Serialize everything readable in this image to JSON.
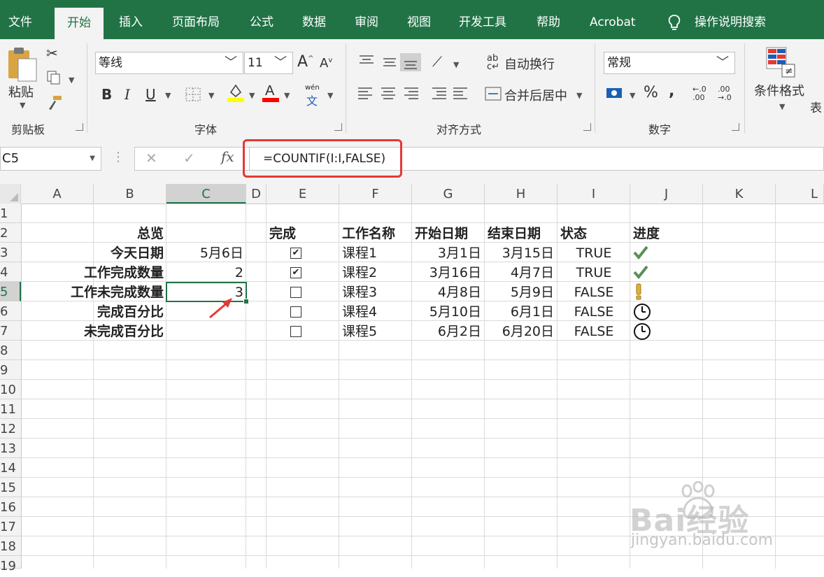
{
  "menu": {
    "tabs": [
      "文件",
      "开始",
      "插入",
      "页面布局",
      "公式",
      "数据",
      "审阅",
      "视图",
      "开发工具",
      "帮助",
      "Acrobat"
    ],
    "active_tab": "开始",
    "search_label": "操作说明搜索"
  },
  "ribbon": {
    "clipboard": {
      "paste": "粘贴",
      "group": "剪贴板"
    },
    "font": {
      "name": "等线",
      "size": "11",
      "bold": "B",
      "italic": "I",
      "underline": "U",
      "phonetic_top": "wén",
      "phonetic": "文",
      "group": "字体",
      "fill_color": "#ffff00",
      "font_color": "#ff0000"
    },
    "alignment": {
      "wrap_text": "自动换行",
      "merge_center": "合并后居中",
      "group": "对齐方式"
    },
    "number": {
      "format": "常规",
      "percent": "%",
      "comma": ",",
      "inc_decimal": "←.0\n.00",
      "dec_decimal": ".00\n→.0",
      "group": "数字"
    },
    "styles": {
      "conditional_formatting": "条件格式",
      "format_table_partial": "表"
    }
  },
  "formula_bar": {
    "name_box": "C5",
    "cancel": "✕",
    "enter": "✓",
    "fx": "fx",
    "formula": "=COUNTIF(I:I,FALSE)"
  },
  "grid": {
    "columns": [
      "A",
      "B",
      "C",
      "D",
      "E",
      "F",
      "G",
      "H",
      "I",
      "J",
      "K",
      "L"
    ],
    "selected_column": "C",
    "rows": [
      "1",
      "2",
      "3",
      "4",
      "5",
      "6",
      "7",
      "8",
      "9",
      "10",
      "11",
      "12",
      "13",
      "14",
      "15",
      "16",
      "17",
      "18",
      "19"
    ],
    "selected_row": "5",
    "summary": {
      "header": "总览",
      "labels": [
        "今天日期",
        "工作完成数量",
        "工作未完成数量",
        "完成百分比",
        "未完成百分比"
      ],
      "values": [
        "5月6日",
        "2",
        "3",
        "",
        ""
      ]
    },
    "table": {
      "headers": [
        "完成",
        "工作名称",
        "开始日期",
        "结束日期",
        "状态",
        "进度"
      ],
      "rows": [
        {
          "done": true,
          "name": "课程1",
          "start": "3月1日",
          "end": "3月15日",
          "status": "TRUE",
          "progress": "check"
        },
        {
          "done": true,
          "name": "课程2",
          "start": "3月16日",
          "end": "4月7日",
          "status": "TRUE",
          "progress": "check"
        },
        {
          "done": false,
          "name": "课程3",
          "start": "4月8日",
          "end": "5月9日",
          "status": "FALSE",
          "progress": "exclamation"
        },
        {
          "done": false,
          "name": "课程4",
          "start": "5月10日",
          "end": "6月1日",
          "status": "FALSE",
          "progress": "clock"
        },
        {
          "done": false,
          "name": "课程5",
          "start": "6月2日",
          "end": "6月20日",
          "status": "FALSE",
          "progress": "clock"
        }
      ]
    }
  },
  "watermark": {
    "brand": "Bai经验",
    "url": "jingyan.baidu.com"
  },
  "colors": {
    "excel_green": "#217346",
    "highlight_red": "#e53935",
    "check_green": "#5a8f5a",
    "exclaim_gold": "#e0b030"
  }
}
